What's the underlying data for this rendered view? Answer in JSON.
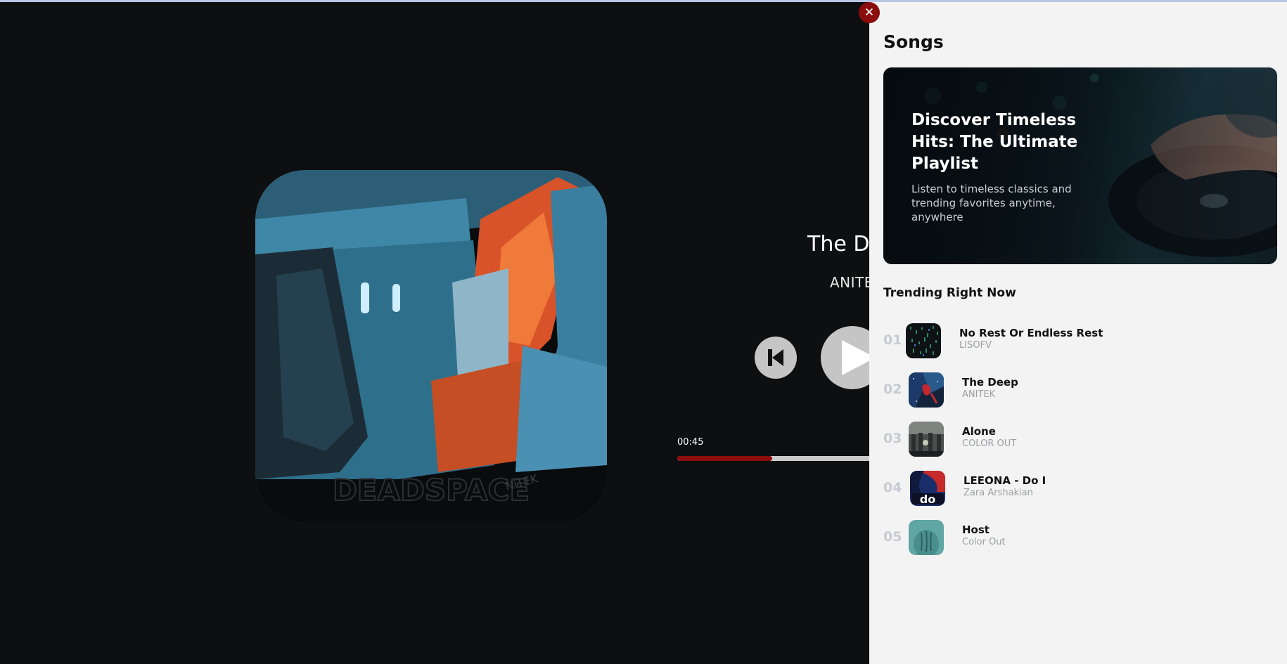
{
  "player": {
    "album_text": "DEADSPACE",
    "album_tag": "NiTEK",
    "track_title": "The Deep",
    "track_artist": "ANITEK",
    "current_time": "00:45",
    "progress": 0.45,
    "icons": {
      "prev": "skip-previous-icon",
      "play": "play-icon"
    }
  },
  "panel": {
    "close_label": "✕",
    "title": "Songs",
    "promo": {
      "title": "Discover Timeless Hits: The Ultimate Playlist",
      "subtitle": "Listen to timeless classics and trending favorites anytime, anywhere"
    },
    "trending_title": "Trending Right Now",
    "songs": [
      {
        "num": "01",
        "title": "No Rest Or Endless Rest",
        "artist": "LISOFV"
      },
      {
        "num": "02",
        "title": "The Deep",
        "artist": "ANITEK"
      },
      {
        "num": "03",
        "title": "Alone",
        "artist": "COLOR OUT"
      },
      {
        "num": "04",
        "title": "LEEONA - Do I",
        "artist": "Zara Arshakian"
      },
      {
        "num": "05",
        "title": "Host",
        "artist": "Color Out"
      }
    ]
  },
  "colors": {
    "accent": "#8b0d0d",
    "panel_bg": "#f3f3f3",
    "page_bg": "#0d0f10"
  }
}
